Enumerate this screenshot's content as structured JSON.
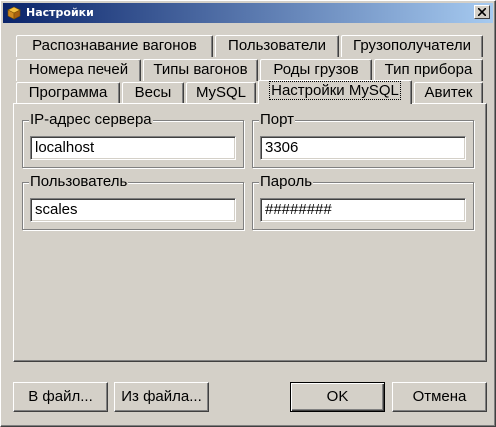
{
  "window": {
    "title": "Настройки",
    "close_icon": "close-icon",
    "app_icon": "cube-icon"
  },
  "tabs": {
    "row1": [
      "Распознавание вагонов",
      "Пользователи",
      "Грузополучатели"
    ],
    "row2": [
      "Номера печей",
      "Типы вагонов",
      "Роды грузов",
      "Тип прибора"
    ],
    "row3": [
      "Программа",
      "Весы",
      "MySQL",
      "Настройки MySQL",
      "Авитек"
    ],
    "active": "Настройки MySQL"
  },
  "mysql": {
    "server_label": "IP-адрес сервера",
    "server_value": "localhost",
    "port_label": "Порт",
    "port_value": "3306",
    "user_label": "Пользователь",
    "user_value": "scales",
    "password_label": "Пароль",
    "password_value": "########"
  },
  "buttons": {
    "to_file": "В файл...",
    "from_file": "Из файла...",
    "ok": "OK",
    "cancel": "Отмена"
  },
  "colors": {
    "titlebar_start": "#0a246a",
    "titlebar_end": "#a6caf0",
    "face": "#d4d0c8"
  }
}
